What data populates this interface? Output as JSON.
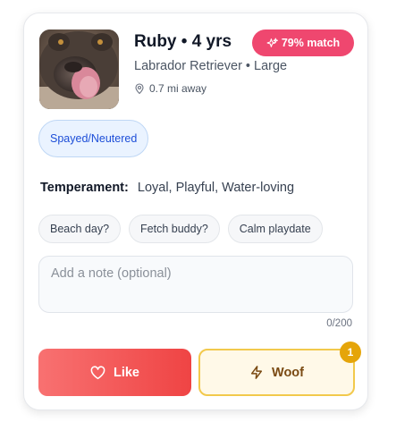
{
  "profile": {
    "photo_icon": "dog-photo",
    "name_age": "Ruby • 4 yrs",
    "breed_size": "Labrador Retriever • Large",
    "distance": "0.7 mi away",
    "distance_icon": "location-pin-icon"
  },
  "match": {
    "label": "79% match",
    "icon": "sparkles-icon",
    "color": "#ef476f"
  },
  "badges": [
    "Spayed/Neutered"
  ],
  "temperament": {
    "label": "Temperament:",
    "value": "Loyal, Playful, Water-loving"
  },
  "suggestions": [
    "Beach day?",
    "Fetch buddy?",
    "Calm playdate"
  ],
  "note": {
    "placeholder": "Add a note (optional)",
    "value": "",
    "counter": "0/200"
  },
  "actions": {
    "like_label": "Like",
    "like_icon": "heart-icon",
    "like_color": "#ef4444",
    "woof_label": "Woof",
    "woof_icon": "lightning-icon",
    "woof_count": "1",
    "woof_color": "#f2c94c"
  }
}
